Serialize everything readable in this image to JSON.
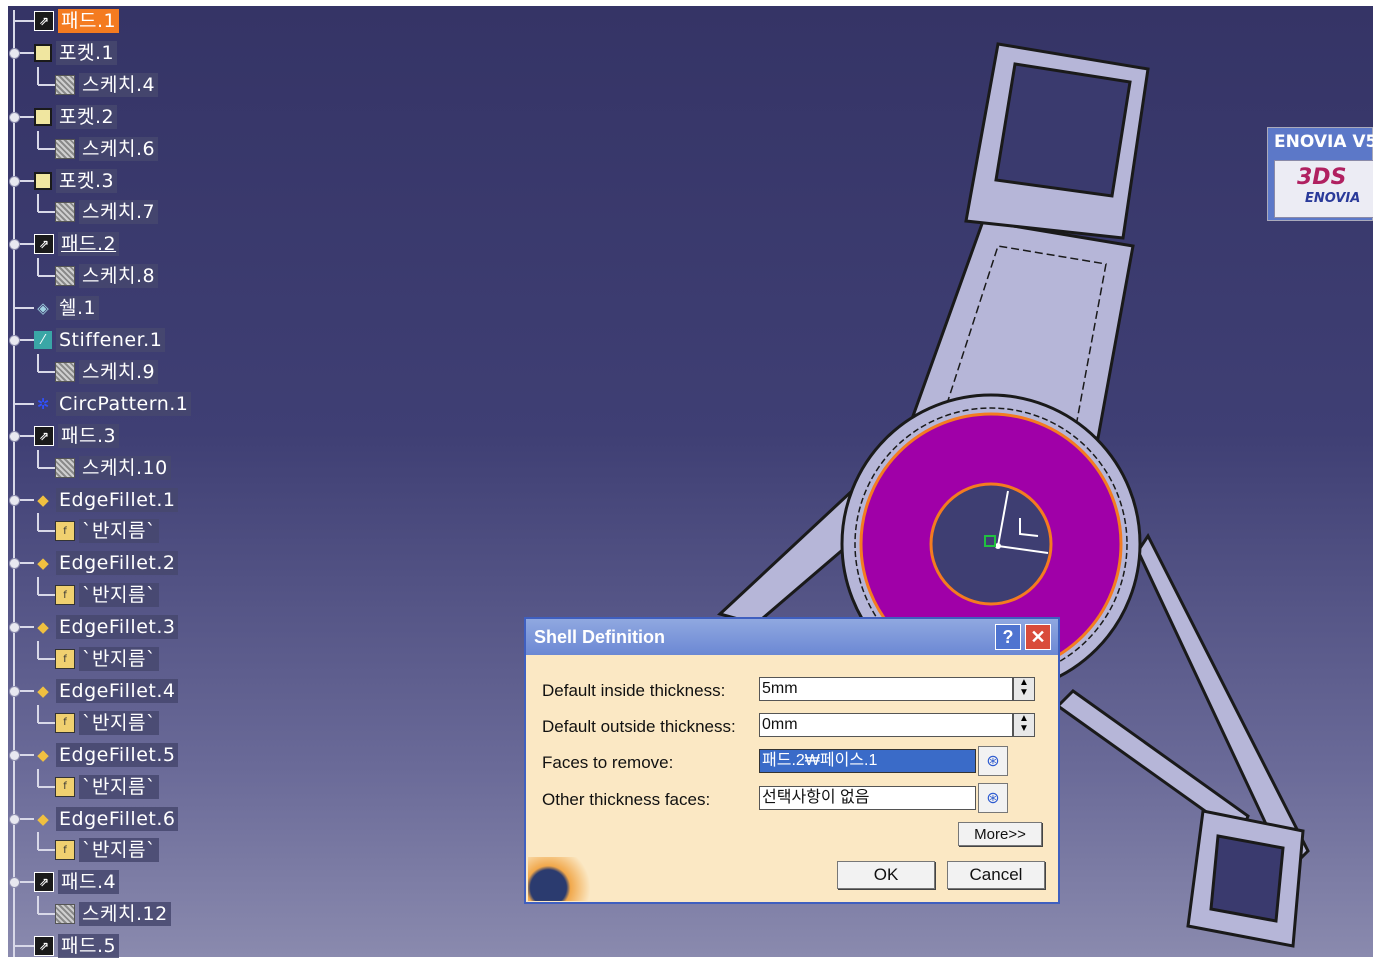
{
  "tree": {
    "items": [
      {
        "label": "패드.1",
        "icon": "pad-icon",
        "level": 0,
        "selected": true
      },
      {
        "label": "포켓.1",
        "icon": "pocket-icon",
        "level": 0
      },
      {
        "label": "스케치.4",
        "icon": "sketch-icon",
        "level": 1
      },
      {
        "label": "포켓.2",
        "icon": "pocket-icon",
        "level": 0
      },
      {
        "label": "스케치.6",
        "icon": "sketch-icon",
        "level": 1
      },
      {
        "label": "포켓.3",
        "icon": "pocket-icon",
        "level": 0
      },
      {
        "label": "스케치.7",
        "icon": "sketch-icon",
        "level": 1
      },
      {
        "label": "패드.2",
        "icon": "pad-icon",
        "level": 0,
        "underline": true
      },
      {
        "label": "스케치.8",
        "icon": "sketch-icon",
        "level": 1
      },
      {
        "label": "쉘.1",
        "icon": "shell-icon",
        "level": 0
      },
      {
        "label": "Stiffener.1",
        "icon": "stiffener-icon",
        "level": 0
      },
      {
        "label": "스케치.9",
        "icon": "sketch-icon",
        "level": 1
      },
      {
        "label": "CircPattern.1",
        "icon": "circpattern-icon",
        "level": 0
      },
      {
        "label": "패드.3",
        "icon": "pad-icon",
        "level": 0
      },
      {
        "label": "스케치.10",
        "icon": "sketch-icon",
        "level": 1
      },
      {
        "label": "EdgeFillet.1",
        "icon": "fillet-icon",
        "level": 0
      },
      {
        "label": "`반지름`",
        "icon": "radius-icon",
        "level": 1
      },
      {
        "label": "EdgeFillet.2",
        "icon": "fillet-icon",
        "level": 0
      },
      {
        "label": "`반지름`",
        "icon": "radius-icon",
        "level": 1
      },
      {
        "label": "EdgeFillet.3",
        "icon": "fillet-icon",
        "level": 0
      },
      {
        "label": "`반지름`",
        "icon": "radius-icon",
        "level": 1
      },
      {
        "label": "EdgeFillet.4",
        "icon": "fillet-icon",
        "level": 0
      },
      {
        "label": "`반지름`",
        "icon": "radius-icon",
        "level": 1
      },
      {
        "label": "EdgeFillet.5",
        "icon": "fillet-icon",
        "level": 0
      },
      {
        "label": "`반지름`",
        "icon": "radius-icon",
        "level": 1
      },
      {
        "label": "EdgeFillet.6",
        "icon": "fillet-icon",
        "level": 0
      },
      {
        "label": "`반지름`",
        "icon": "radius-icon",
        "level": 1
      },
      {
        "label": "패드.4",
        "icon": "pad-icon",
        "level": 0
      },
      {
        "label": "스케치.12",
        "icon": "sketch-icon",
        "level": 1
      },
      {
        "label": "패드.5",
        "icon": "pad-icon",
        "level": 0
      }
    ]
  },
  "enovia": {
    "title": "ENOVIA V5",
    "logo_text": "ENOVIA",
    "logo_mark": "3DS"
  },
  "dialog": {
    "title": "Shell Definition",
    "help_label": "?",
    "close_label": "✕",
    "inside_label": "Default inside thickness:",
    "inside_value": "5mm",
    "outside_label": "Default outside thickness:",
    "outside_value": "0mm",
    "faces_label": "Faces to remove:",
    "faces_value": "패드.2₩페이스.1",
    "other_label": "Other thickness faces:",
    "other_value": "선택사항이 없음",
    "more_label": "More>>",
    "ok_label": "OK",
    "cancel_label": "Cancel"
  },
  "colors": {
    "background_top": "#353466",
    "background_bottom": "#8a8aae",
    "part_body": "#b4b4d6",
    "selected_face": "#a000a8",
    "highlight": "#f47b20",
    "dialog_bg": "#fbe8c4",
    "titlebar": "#6b88d4"
  }
}
